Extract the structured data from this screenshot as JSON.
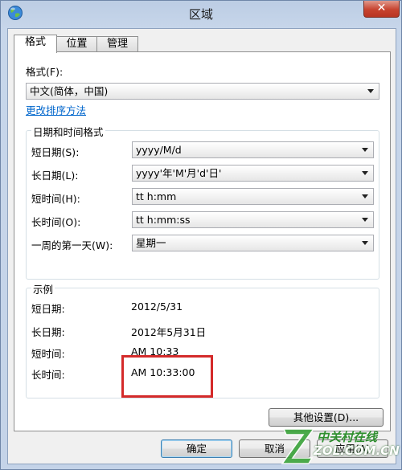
{
  "window": {
    "title": "区域",
    "close_glyph": "✕"
  },
  "tabs": [
    {
      "label": "格式",
      "active": true
    },
    {
      "label": "位置",
      "active": false
    },
    {
      "label": "管理",
      "active": false
    }
  ],
  "format": {
    "label": "格式(F):",
    "value": "中文(简体，中国)",
    "link": "更改排序方法"
  },
  "datetime_group": {
    "title": "日期和时间格式",
    "rows": [
      {
        "label": "短日期(S):",
        "value": "yyyy/M/d"
      },
      {
        "label": "长日期(L):",
        "value": "yyyy'年'M'月'd'日'"
      },
      {
        "label": "短时间(H):",
        "value": "tt h:mm"
      },
      {
        "label": "长时间(O):",
        "value": "tt h:mm:ss"
      },
      {
        "label": "一周的第一天(W):",
        "value": "星期一"
      }
    ]
  },
  "example_group": {
    "title": "示例",
    "rows": [
      {
        "label": "短日期:",
        "value": "2012/5/31"
      },
      {
        "label": "长日期:",
        "value": "2012年5月31日"
      },
      {
        "label": "短时间:",
        "value": "AM 10:33"
      },
      {
        "label": "长时间:",
        "value": "AM 10:33:00"
      }
    ]
  },
  "buttons": {
    "other_settings": "其他设置(D)...",
    "ok": "确定",
    "cancel": "取消",
    "apply": "应用(A)"
  },
  "watermark": {
    "cn": "中关村在线",
    "en": "ZOL.COM.CN"
  },
  "colors": {
    "highlight": "#d42a2a",
    "link": "#0066cc",
    "close": "#c7432f"
  }
}
